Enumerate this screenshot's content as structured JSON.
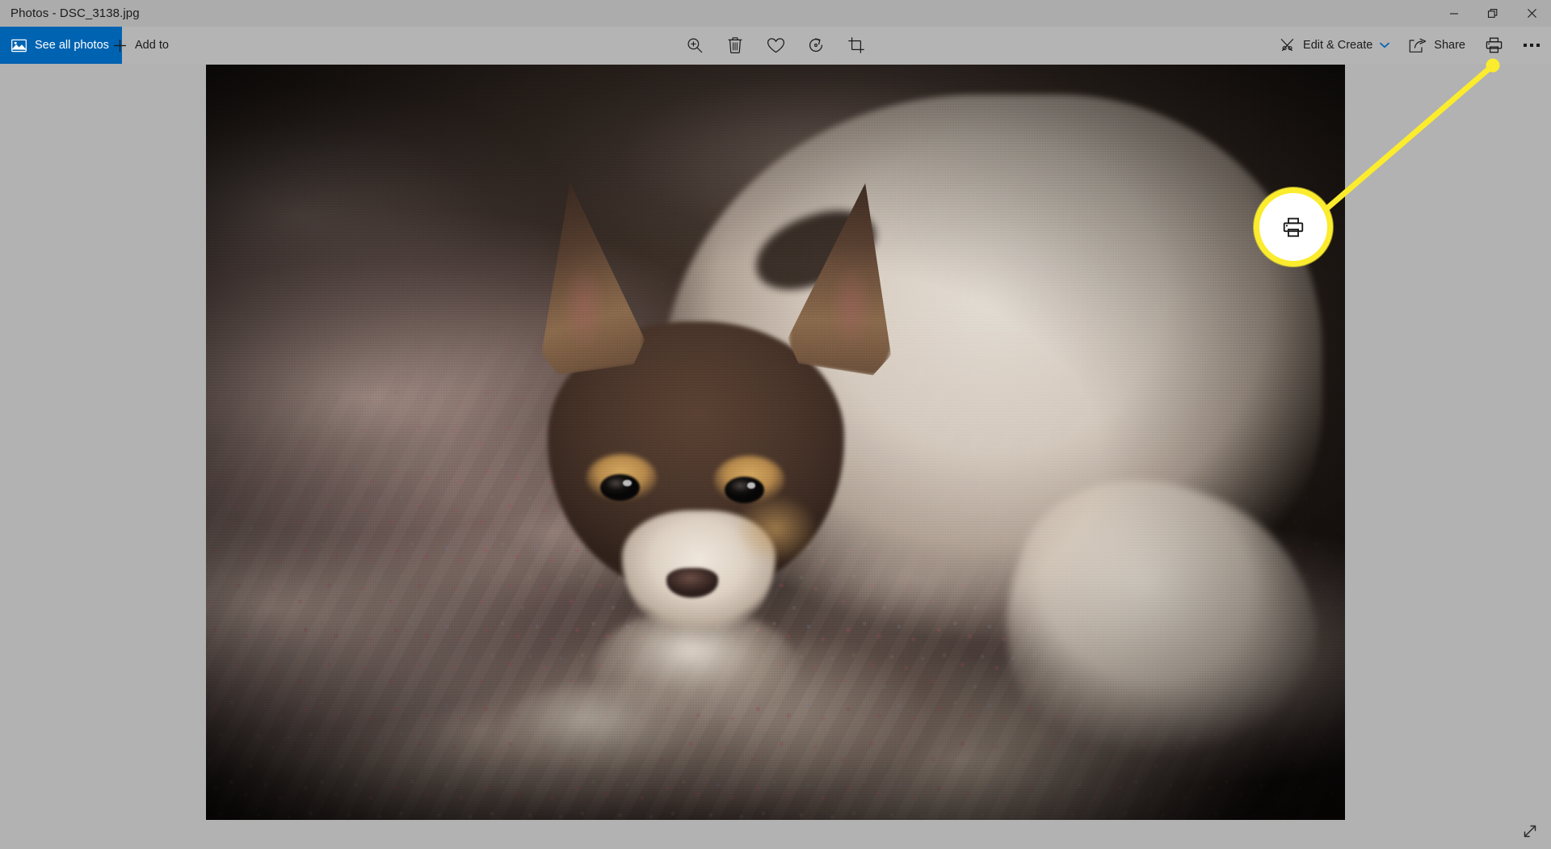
{
  "window": {
    "title": "Photos - DSC_3138.jpg",
    "controls": [
      {
        "name": "minimize",
        "label": "Minimize"
      },
      {
        "name": "restore",
        "label": "Restore Down"
      },
      {
        "name": "close",
        "label": "Close"
      }
    ]
  },
  "commandbar": {
    "see_all_photos": {
      "label": "See all photos",
      "icon": "photo-library-icon",
      "accent": "#0063b1"
    },
    "add_to": {
      "label": "Add to",
      "icon": "plus-icon"
    },
    "center_tools": [
      {
        "name": "zoom",
        "icon": "zoom-in-icon",
        "tooltip": "Zoom"
      },
      {
        "name": "delete",
        "icon": "trash-icon",
        "tooltip": "Delete"
      },
      {
        "name": "favorite",
        "icon": "heart-icon",
        "tooltip": "Add to favorites"
      },
      {
        "name": "rotate",
        "icon": "rotate-icon",
        "tooltip": "Rotate"
      },
      {
        "name": "crop",
        "icon": "crop-icon",
        "tooltip": "Crop & rotate"
      }
    ],
    "edit_create": {
      "label": "Edit & Create",
      "icon": "edit-create-icon",
      "chevron": "chevron-down-icon"
    },
    "share": {
      "label": "Share",
      "icon": "share-icon"
    },
    "print": {
      "label": "Print",
      "icon": "printer-icon"
    },
    "more": {
      "label": "See more",
      "icon": "ellipsis-icon"
    }
  },
  "annotation": {
    "target": "print",
    "icon": "printer-icon",
    "highlight_color": "#fbec2d",
    "fill_color": "#ffffff"
  },
  "photo": {
    "alt": "Brown and white rat terrier dog lying on a floral quilt",
    "filename": "DSC_3138.jpg"
  },
  "statusbar": {
    "resize_grip": {
      "icon": "resize-diagonal-icon",
      "label": "Resize window"
    }
  },
  "colors": {
    "titlebar": "#acacac",
    "commandbar": "#b4b4b4",
    "canvas": "#b2b2b2",
    "accent": "#0063b1",
    "highlight": "#fbec2d",
    "text": "#1b1b1b"
  }
}
